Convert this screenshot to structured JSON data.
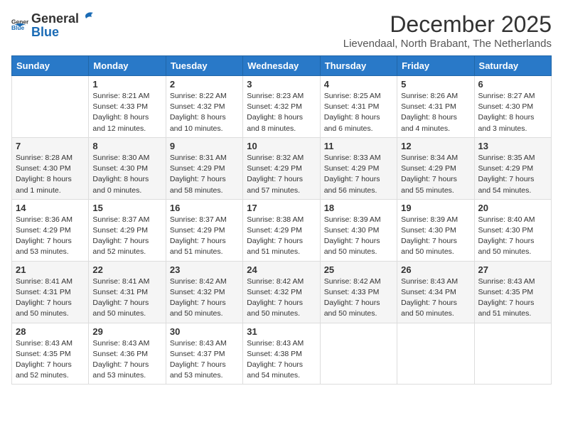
{
  "logo": {
    "general": "General",
    "blue": "Blue"
  },
  "title": "December 2025",
  "location": "Lievendaal, North Brabant, The Netherlands",
  "days_of_week": [
    "Sunday",
    "Monday",
    "Tuesday",
    "Wednesday",
    "Thursday",
    "Friday",
    "Saturday"
  ],
  "weeks": [
    [
      {
        "day": "",
        "info": ""
      },
      {
        "day": "1",
        "info": "Sunrise: 8:21 AM\nSunset: 4:33 PM\nDaylight: 8 hours\nand 12 minutes."
      },
      {
        "day": "2",
        "info": "Sunrise: 8:22 AM\nSunset: 4:32 PM\nDaylight: 8 hours\nand 10 minutes."
      },
      {
        "day": "3",
        "info": "Sunrise: 8:23 AM\nSunset: 4:32 PM\nDaylight: 8 hours\nand 8 minutes."
      },
      {
        "day": "4",
        "info": "Sunrise: 8:25 AM\nSunset: 4:31 PM\nDaylight: 8 hours\nand 6 minutes."
      },
      {
        "day": "5",
        "info": "Sunrise: 8:26 AM\nSunset: 4:31 PM\nDaylight: 8 hours\nand 4 minutes."
      },
      {
        "day": "6",
        "info": "Sunrise: 8:27 AM\nSunset: 4:30 PM\nDaylight: 8 hours\nand 3 minutes."
      }
    ],
    [
      {
        "day": "7",
        "info": "Sunrise: 8:28 AM\nSunset: 4:30 PM\nDaylight: 8 hours\nand 1 minute."
      },
      {
        "day": "8",
        "info": "Sunrise: 8:30 AM\nSunset: 4:30 PM\nDaylight: 8 hours\nand 0 minutes."
      },
      {
        "day": "9",
        "info": "Sunrise: 8:31 AM\nSunset: 4:29 PM\nDaylight: 7 hours\nand 58 minutes."
      },
      {
        "day": "10",
        "info": "Sunrise: 8:32 AM\nSunset: 4:29 PM\nDaylight: 7 hours\nand 57 minutes."
      },
      {
        "day": "11",
        "info": "Sunrise: 8:33 AM\nSunset: 4:29 PM\nDaylight: 7 hours\nand 56 minutes."
      },
      {
        "day": "12",
        "info": "Sunrise: 8:34 AM\nSunset: 4:29 PM\nDaylight: 7 hours\nand 55 minutes."
      },
      {
        "day": "13",
        "info": "Sunrise: 8:35 AM\nSunset: 4:29 PM\nDaylight: 7 hours\nand 54 minutes."
      }
    ],
    [
      {
        "day": "14",
        "info": "Sunrise: 8:36 AM\nSunset: 4:29 PM\nDaylight: 7 hours\nand 53 minutes."
      },
      {
        "day": "15",
        "info": "Sunrise: 8:37 AM\nSunset: 4:29 PM\nDaylight: 7 hours\nand 52 minutes."
      },
      {
        "day": "16",
        "info": "Sunrise: 8:37 AM\nSunset: 4:29 PM\nDaylight: 7 hours\nand 51 minutes."
      },
      {
        "day": "17",
        "info": "Sunrise: 8:38 AM\nSunset: 4:29 PM\nDaylight: 7 hours\nand 51 minutes."
      },
      {
        "day": "18",
        "info": "Sunrise: 8:39 AM\nSunset: 4:30 PM\nDaylight: 7 hours\nand 50 minutes."
      },
      {
        "day": "19",
        "info": "Sunrise: 8:39 AM\nSunset: 4:30 PM\nDaylight: 7 hours\nand 50 minutes."
      },
      {
        "day": "20",
        "info": "Sunrise: 8:40 AM\nSunset: 4:30 PM\nDaylight: 7 hours\nand 50 minutes."
      }
    ],
    [
      {
        "day": "21",
        "info": "Sunrise: 8:41 AM\nSunset: 4:31 PM\nDaylight: 7 hours\nand 50 minutes."
      },
      {
        "day": "22",
        "info": "Sunrise: 8:41 AM\nSunset: 4:31 PM\nDaylight: 7 hours\nand 50 minutes."
      },
      {
        "day": "23",
        "info": "Sunrise: 8:42 AM\nSunset: 4:32 PM\nDaylight: 7 hours\nand 50 minutes."
      },
      {
        "day": "24",
        "info": "Sunrise: 8:42 AM\nSunset: 4:32 PM\nDaylight: 7 hours\nand 50 minutes."
      },
      {
        "day": "25",
        "info": "Sunrise: 8:42 AM\nSunset: 4:33 PM\nDaylight: 7 hours\nand 50 minutes."
      },
      {
        "day": "26",
        "info": "Sunrise: 8:43 AM\nSunset: 4:34 PM\nDaylight: 7 hours\nand 50 minutes."
      },
      {
        "day": "27",
        "info": "Sunrise: 8:43 AM\nSunset: 4:35 PM\nDaylight: 7 hours\nand 51 minutes."
      }
    ],
    [
      {
        "day": "28",
        "info": "Sunrise: 8:43 AM\nSunset: 4:35 PM\nDaylight: 7 hours\nand 52 minutes."
      },
      {
        "day": "29",
        "info": "Sunrise: 8:43 AM\nSunset: 4:36 PM\nDaylight: 7 hours\nand 53 minutes."
      },
      {
        "day": "30",
        "info": "Sunrise: 8:43 AM\nSunset: 4:37 PM\nDaylight: 7 hours\nand 53 minutes."
      },
      {
        "day": "31",
        "info": "Sunrise: 8:43 AM\nSunset: 4:38 PM\nDaylight: 7 hours\nand 54 minutes."
      },
      {
        "day": "",
        "info": ""
      },
      {
        "day": "",
        "info": ""
      },
      {
        "day": "",
        "info": ""
      }
    ]
  ]
}
